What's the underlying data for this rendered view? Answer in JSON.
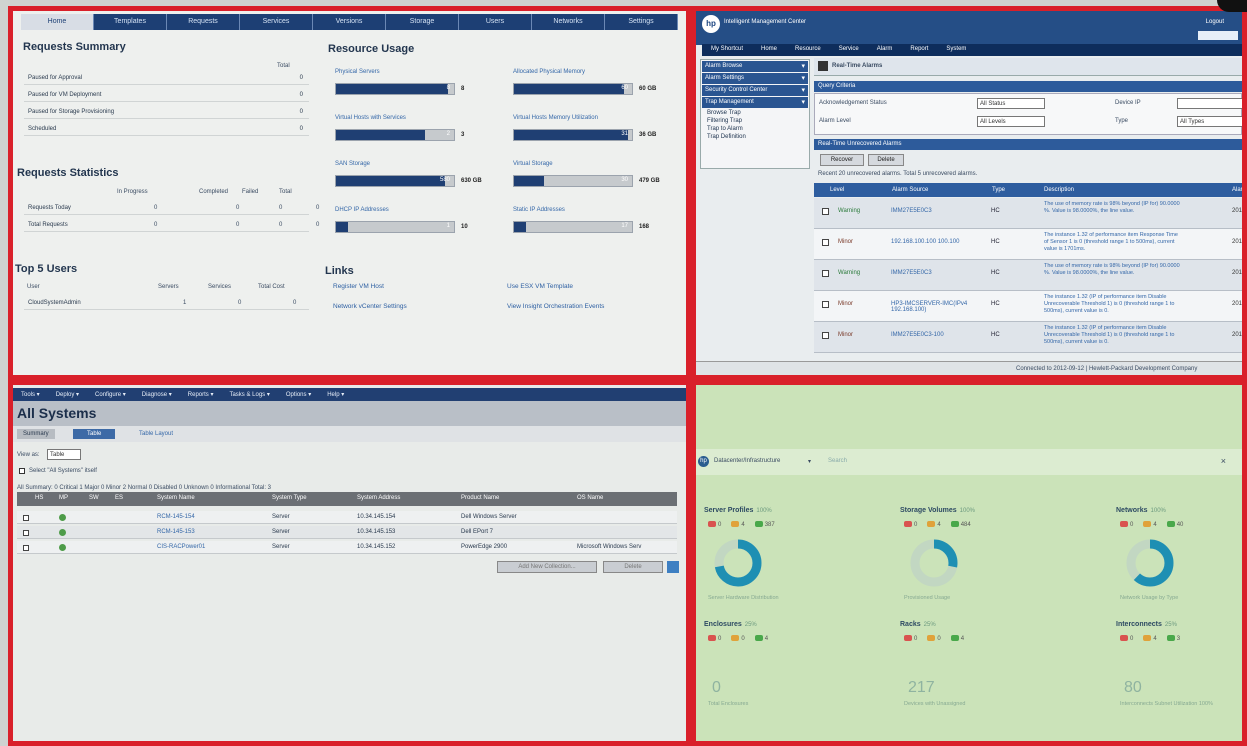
{
  "p1": {
    "tabs": [
      "Home",
      "Templates",
      "Requests",
      "Services",
      "Versions",
      "Storage",
      "Users",
      "Networks",
      "Settings"
    ],
    "requests_summary": {
      "title": "Requests Summary",
      "col": "Total",
      "rows": [
        {
          "label": "Paused for Approval",
          "value": "0"
        },
        {
          "label": "Paused for VM Deployment",
          "value": "0"
        },
        {
          "label": "Paused for Storage Provisioning",
          "value": "0"
        },
        {
          "label": "Scheduled",
          "value": "0"
        }
      ]
    },
    "requests_stats": {
      "title": "Requests Statistics",
      "cols": [
        "In Progress",
        "Completed",
        "Failed",
        "Total"
      ],
      "rows": [
        {
          "label": "Requests Today",
          "v": [
            "0",
            "0",
            "0",
            "0"
          ]
        },
        {
          "label": "Total Requests",
          "v": [
            "0",
            "0",
            "0",
            "0"
          ]
        }
      ]
    },
    "top_users": {
      "title": "Top 5 Users",
      "cols": [
        "User",
        "Servers",
        "Services",
        "Total Cost"
      ],
      "rows": [
        {
          "label": "CloudSystemAdmin",
          "v": [
            "1",
            "0",
            "0"
          ]
        }
      ]
    },
    "resource_usage": {
      "title": "Resource Usage",
      "items": [
        {
          "label": "Physical Servers",
          "fill": 0.95,
          "inner": "8",
          "value": "8"
        },
        {
          "label": "Allocated Physical Memory",
          "fill": 0.93,
          "inner": "60",
          "value": "60 GB"
        },
        {
          "label": "Virtual Hosts with Services",
          "fill": 0.75,
          "inner": "2",
          "value": "3"
        },
        {
          "label": "Virtual Hosts Memory Utilization",
          "fill": 0.97,
          "inner": "31",
          "value": "36 GB"
        },
        {
          "label": "SAN Storage",
          "fill": 0.92,
          "inner": "580",
          "value": "630 GB"
        },
        {
          "label": "Virtual Storage",
          "fill": 0.25,
          "inner": "30",
          "value": "479 GB"
        },
        {
          "label": "DHCP IP Addresses",
          "fill": 0.1,
          "inner": "1",
          "value": "10"
        },
        {
          "label": "Static IP Addresses",
          "fill": 0.1,
          "inner": "17",
          "value": "168"
        }
      ]
    },
    "links": {
      "title": "Links",
      "items": [
        "Register VM Host",
        "Use ESX VM Template",
        "Network vCenter Settings",
        "View Insight Orchestration Events"
      ]
    }
  },
  "p2": {
    "app_title": "Intelligent Management Center",
    "user": "admin",
    "logout": "Logout",
    "subnav": [
      "My Shortcut",
      "Home",
      "Resource",
      "Service",
      "Alarm",
      "Report",
      "System"
    ],
    "sidebar": {
      "headers": [
        "Alarm Browse",
        "Alarm Settings",
        "Security Control Center",
        "Trap Management"
      ],
      "items": [
        "Browse Trap",
        "Filtering Trap",
        "Trap to Alarm",
        "Trap Definition"
      ]
    },
    "page_title": "Real-Time Alarms",
    "query": {
      "title": "Query Criteria",
      "fields": [
        {
          "label": "Acknowledgement Status",
          "value": "All Status"
        },
        {
          "label": "Alarm Level",
          "value": "All Levels"
        }
      ],
      "right": [
        {
          "label": "Device IP",
          "value": ""
        },
        {
          "label": "Type",
          "value": "All Types"
        }
      ]
    },
    "unack": {
      "title": "Real-Time Unrecovered Alarms",
      "buttons": [
        "Recover",
        "Delete"
      ],
      "summary": "Recent 20 unrecovered alarms. Total 5 unrecovered alarms.",
      "cols": [
        "Level",
        "Alarm Source",
        "Type",
        "Description",
        "Alarm Ti"
      ]
    },
    "alarms": [
      {
        "level": "Warning",
        "src": "IMM27E5E0C3",
        "type": "HC",
        "desc": "The use of memory rate is 98% beyond (IP for) 90.0000 %. Value is 98.0000%, the line value.",
        "time": "2012-0"
      },
      {
        "level": "Minor",
        "src": "192.168.100.100 100.100",
        "type": "HC",
        "desc": "The instance 1.32 of performance item Response Time of Sensor 1 is 0 (threshold range 1 to 500ms), current value is 1701ms.",
        "time": "2012-0"
      },
      {
        "level": "Warning",
        "src": "IMM27E5E0C3",
        "type": "HC",
        "desc": "The use of memory rate is 98% beyond (IP for) 90.0000 %. Value is 98.0000%, the line value.",
        "time": "2012-0"
      },
      {
        "level": "Minor",
        "src": "HP3-IMCSERVER-IMC(IPv4 192.168.100)",
        "type": "HC",
        "desc": "The instance 1.32 (IP of performance item Disable Unrecoverable Threshold 1) is 0 (threshold range 1 to 500ms), current value is 0.",
        "time": "2012-0"
      },
      {
        "level": "Minor",
        "src": "IMM27E5E0C3-100",
        "type": "HC",
        "desc": "The instance 1.32 (IP of performance item Disable Unrecoverable Threshold 1) is 0 (threshold range 1 to 500ms), current value is 0.",
        "time": "2012-0"
      }
    ],
    "status": "Connected to 2012-09-12 | Hewlett-Packard Development Company"
  },
  "p3": {
    "menu": [
      "Tools ▾",
      "Deploy ▾",
      "Configure ▾",
      "Diagnose ▾",
      "Reports ▾",
      "Tasks & Logs ▾",
      "Options ▾",
      "Help ▾"
    ],
    "title": "All Systems",
    "tabs": [
      "Summary",
      "Table",
      "Table Layout"
    ],
    "view_as_label": "View as:",
    "view_as": "Table",
    "select_all": "Select \"All Systems\" itself",
    "legend": "All Summary: 0 Critical 1 Major 0 Minor 2 Normal 0 Disabled 0 Unknown 0 Informational  Total: 3",
    "cols": [
      "HS",
      "MP",
      "SW",
      "ES",
      "System Name",
      "System Type",
      "System Address",
      "Product Name",
      "OS Name"
    ],
    "rows": [
      {
        "name": "RCM-145-154",
        "type": "Server",
        "addr": "10.34.145.154",
        "product": "Dell Windows Server",
        "os": ""
      },
      {
        "name": "RCM-145-153",
        "type": "Server",
        "addr": "10.34.145.153",
        "product": "Dell EPort 7",
        "os": ""
      },
      {
        "name": "CIS-RACPower01",
        "type": "Server",
        "addr": "10.34.145.152",
        "product": "PowerEdge 2900",
        "os": "Microsoft Windows Serv"
      }
    ],
    "buttons": [
      "Add New Collection...",
      "Delete"
    ]
  },
  "p4": {
    "scope": "Datacenter/Infrastructure",
    "search_placeholder": "Search",
    "cards": [
      {
        "title": "Server Profiles",
        "sub": "100%",
        "counts": [
          "0",
          "4",
          "387"
        ],
        "label": "Server Hardware Distribution",
        "donut": 0.72
      },
      {
        "title": "Storage Volumes",
        "sub": "100%",
        "counts": [
          "0",
          "4",
          "484"
        ],
        "label": "Provisioned Usage",
        "donut": 0.28
      },
      {
        "title": "Networks",
        "sub": "100%",
        "counts": [
          "0",
          "4",
          "40"
        ],
        "label": "Network Usage by Type",
        "donut": 0.62
      },
      {
        "title": "Enclosures",
        "sub": "25%",
        "counts": [
          "0",
          "0",
          "4"
        ],
        "big": "0",
        "label": "Total Enclosures"
      },
      {
        "title": "Racks",
        "sub": "25%",
        "counts": [
          "0",
          "0",
          "4"
        ],
        "big": "217",
        "label": "Devices with Unassigned"
      },
      {
        "title": "Interconnects",
        "sub": "25%",
        "counts": [
          "0",
          "4",
          "3"
        ],
        "big": "80",
        "label": "Interconnects Subnet Utilization 100%"
      }
    ]
  },
  "colors": {
    "frame": "#d9202a",
    "navy": "#1f3f73",
    "green_panel": "#cbe3b9",
    "teal": "#1e8fb3"
  }
}
